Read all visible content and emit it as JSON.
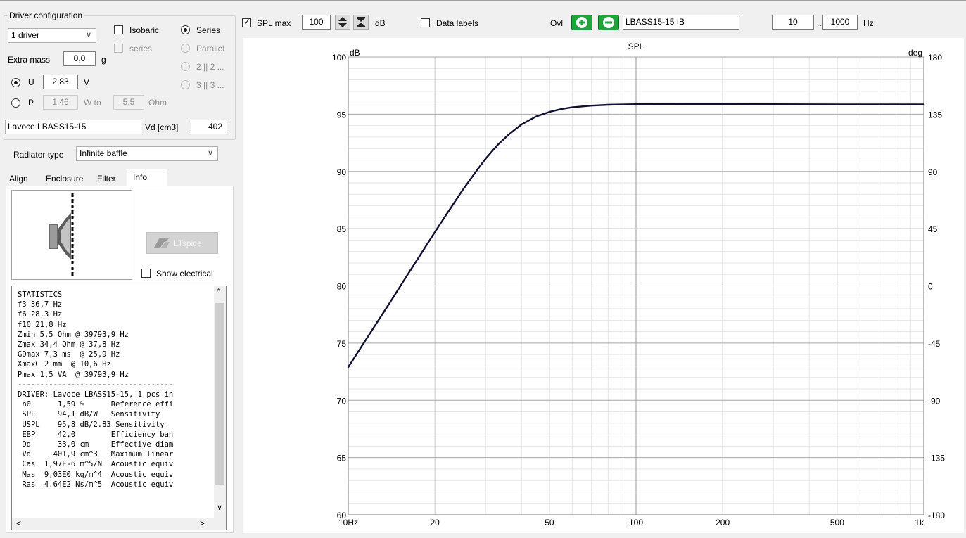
{
  "driver_config": {
    "group_title": "Driver configuration",
    "driver_count": "1 driver",
    "isobaric_label": "Isobaric",
    "isobaric_series_label": "series",
    "series_label": "Series",
    "parallel_label": "Parallel",
    "two_two_label": "2 || 2 ...",
    "three_three_label": "3 || 3 ...",
    "extra_mass_label": "Extra mass",
    "extra_mass_value": "0,0",
    "extra_mass_unit": "g",
    "u_label": "U",
    "u_value": "2,83",
    "u_unit": "V",
    "p_label": "P",
    "p_value": "1,46",
    "w_to_label": "W to",
    "ohm_value": "5,5",
    "ohm_unit": "Ohm",
    "driver_name": "Lavoce LBASS15-15",
    "vd_label": "Vd [cm3]",
    "vd_value": "402"
  },
  "radiator": {
    "label": "Radiator type",
    "value": "Infinite baffle"
  },
  "tabs": [
    {
      "label": "Align"
    },
    {
      "label": "Enclosure"
    },
    {
      "label": "Filter"
    },
    {
      "label": "Info"
    }
  ],
  "info_panel": {
    "ltspice_label": "LTspice",
    "show_electrical_label": "Show electrical",
    "stats_lines": [
      "STATISTICS",
      "f3 36,7 Hz",
      "f6 28,3 Hz",
      "f10 21,8 Hz",
      "Zmin 5,5 Ohm @ 39793,9 Hz",
      "Zmax 34,4 Ohm @ 37,8 Hz",
      "GDmax 7,3 ms  @ 25,9 Hz",
      "XmaxC 2 mm  @ 10,6 Hz",
      "Pmax 1,5 VA  @ 39793,9 Hz",
      "-----------------------------------",
      "DRIVER: Lavoce LBASS15-15, 1 pcs in",
      " n0      1,59 %      Reference effi",
      " SPL     94,1 dB/W   Sensitivity",
      " USPL    95,8 dB/2.83 Sensitivity",
      " EBP     42,0        Efficiency ban",
      " Dd      33,0 cm     Effective diam",
      " Vd     401,9 cm^3   Maximum linear",
      " Cas  1,97E-6 m^5/N  Acoustic equiv",
      " Mas  9,03E0 kg/m^4  Acoustic equiv",
      " Ras  4.64E2 Ns/m^5  Acoustic equiv"
    ]
  },
  "toolbar": {
    "spl_max_label": "SPL max",
    "spl_max_value": "100",
    "db_label": "dB",
    "data_labels_label": "Data labels",
    "ovl_label": "Ovl",
    "overlay_name": "LBASS15-15 IB",
    "freq_min": "10",
    "ellipsis": "...",
    "freq_max": "1000",
    "hz_label": "Hz"
  },
  "chart_data": {
    "type": "line",
    "title": "SPL",
    "ylabel": "dB",
    "y2label": "deg",
    "xscale": "log",
    "xlim": [
      10,
      1000
    ],
    "ylim": [
      60,
      100
    ],
    "y2lim": [
      -180,
      180
    ],
    "x_tick_labels": [
      "10Hz",
      "20",
      "50",
      "100",
      "200",
      "500",
      "1k"
    ],
    "x_tick_values": [
      10,
      20,
      50,
      100,
      200,
      500,
      1000
    ],
    "y_ticks": [
      60,
      65,
      70,
      75,
      80,
      85,
      90,
      95,
      100
    ],
    "y2_ticks": [
      -180,
      -135,
      -90,
      -45,
      0,
      45,
      90,
      135,
      180
    ],
    "grid": true,
    "series": [
      {
        "color": "#101030",
        "x": [
          10,
          12,
          14,
          16,
          18,
          20,
          22,
          25,
          28,
          30,
          33,
          36,
          40,
          45,
          50,
          55,
          60,
          70,
          80,
          100,
          150,
          200,
          300,
          500,
          700,
          1000
        ],
        "y": [
          72.9,
          76.0,
          78.6,
          80.9,
          82.9,
          84.7,
          86.3,
          88.4,
          90.1,
          91.1,
          92.3,
          93.2,
          94.1,
          94.8,
          95.2,
          95.45,
          95.6,
          95.75,
          95.82,
          95.87,
          95.88,
          95.88,
          95.87,
          95.86,
          95.86,
          95.85
        ]
      }
    ]
  }
}
